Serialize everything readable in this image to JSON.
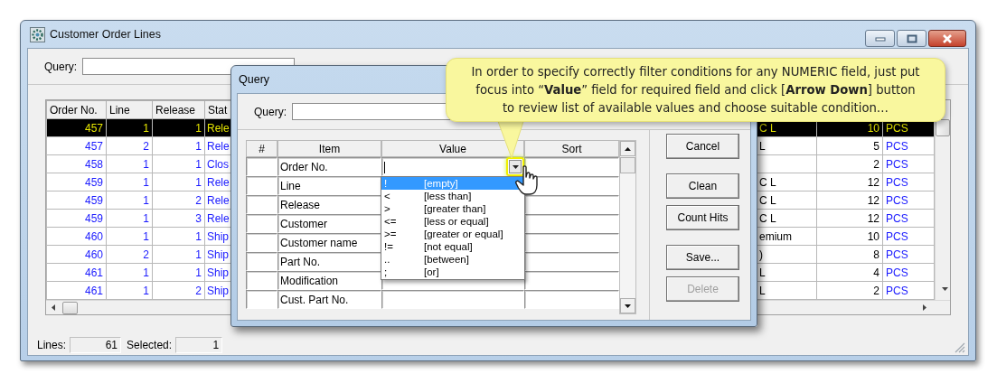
{
  "window": {
    "title": "Customer Order Lines",
    "query_label": "Query:"
  },
  "grid": {
    "columns": [
      "Order No.",
      "Line",
      "Release",
      "Stat"
    ],
    "rows": [
      {
        "order_no": "457",
        "line": "1",
        "release": "1",
        "state": "Rele",
        "column_5": "C L",
        "quantity": "10",
        "unit": "PCS",
        "selected": true
      },
      {
        "order_no": "457",
        "line": "2",
        "release": "1",
        "state": "Rele",
        "column_5": "L",
        "quantity": "5",
        "unit": "PCS",
        "selected": false
      },
      {
        "order_no": "458",
        "line": "1",
        "release": "1",
        "state": "Clos",
        "quantity": "2",
        "unit": "PCS",
        "selected": false
      },
      {
        "order_no": "459",
        "line": "1",
        "release": "1",
        "state": "Rele",
        "column_5": "C L",
        "quantity": "12",
        "unit": "PCS",
        "selected": false
      },
      {
        "order_no": "459",
        "line": "1",
        "release": "2",
        "state": "Rele",
        "column_5": "C L",
        "quantity": "12",
        "unit": "PCS",
        "selected": false
      },
      {
        "order_no": "459",
        "line": "1",
        "release": "3",
        "state": "Rele",
        "column_5": "C L",
        "quantity": "12",
        "unit": "PCS",
        "selected": false
      },
      {
        "order_no": "460",
        "line": "1",
        "release": "1",
        "state": "Ship",
        "column_5": "emium",
        "quantity": "10",
        "unit": "PCS",
        "selected": false
      },
      {
        "order_no": "460",
        "line": "2",
        "release": "1",
        "state": "Ship",
        "column_5": ")",
        "quantity": "8",
        "unit": "PCS",
        "selected": false
      },
      {
        "order_no": "461",
        "line": "1",
        "release": "1",
        "state": "Ship",
        "column_5": "L",
        "quantity": "4",
        "unit": "PCS",
        "selected": false
      },
      {
        "order_no": "461",
        "line": "1",
        "release": "2",
        "state": "Ship",
        "column_5": "L",
        "quantity": "2",
        "unit": "PCS",
        "selected": false
      }
    ]
  },
  "status_bar": {
    "lines_label": "Lines:",
    "lines": "61",
    "selected_label": "Selected:",
    "selected_count": "1"
  },
  "dialog": {
    "title": "Query",
    "query_label": "Query:",
    "columns": [
      "#",
      "Item",
      "Value",
      "Sort"
    ],
    "rows": [
      {
        "item": "Order No.",
        "kind": "active"
      },
      {
        "item": "Line",
        "kind": "plain"
      },
      {
        "item": "Release",
        "kind": "plain"
      },
      {
        "item": "Customer",
        "kind": "plain"
      },
      {
        "item": "Customer name",
        "kind": "plain"
      },
      {
        "item": "Part No.",
        "kind": "plain"
      },
      {
        "item": "Modification",
        "kind": "plain"
      },
      {
        "item": "Cust. Part No.",
        "kind": "plain"
      }
    ],
    "buttons": [
      {
        "label": "Cancel",
        "disabled": false
      },
      {
        "label": "Clean",
        "disabled": false
      },
      {
        "label": "Count Hits",
        "disabled": false
      },
      {
        "label": "Save...",
        "disabled": false
      },
      {
        "label": "Delete",
        "disabled": true
      }
    ]
  },
  "dropdown": {
    "items": [
      {
        "operator": "!",
        "label": "[empty]",
        "selected": true
      },
      {
        "operator": "<",
        "label": "[less than]",
        "selected": false
      },
      {
        "operator": ">",
        "label": "[greater than]",
        "selected": false
      },
      {
        "operator": "<=",
        "label": "[less or equal]",
        "selected": false
      },
      {
        "operator": ">=",
        "label": "[greater or equal]",
        "selected": false
      },
      {
        "operator": "!=",
        "label": "[not equal]",
        "selected": false
      },
      {
        "operator": "..",
        "label": "[between]",
        "selected": false
      },
      {
        "operator": ";",
        "label": "[or]",
        "selected": false
      }
    ]
  },
  "callout": {
    "text": "In order to specify correctly filter conditions for any NUMERIC field, just put focus into “**Value**” field for required field and click [**Arrow Down**] button to review list of available values and choose suitable condition…"
  }
}
